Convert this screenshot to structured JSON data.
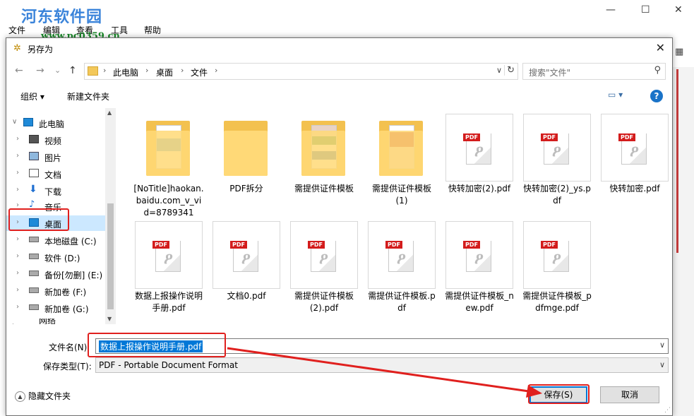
{
  "bg_app": {
    "menu": [
      "文件",
      "编辑",
      "查看",
      "工具",
      "帮助"
    ],
    "watermark": "河东软件园",
    "watermark_url": "www.pc0359.cn",
    "win_min": "—",
    "win_max": "☐",
    "win_close": "✕"
  },
  "dialog": {
    "title": "另存为",
    "close": "✕",
    "nav": {
      "back": "←",
      "forward": "→",
      "recent": "⌄",
      "up": "↑"
    },
    "breadcrumb": [
      "此电脑",
      "桌面",
      "文件"
    ],
    "search_placeholder": "搜索\"文件\"",
    "toolbar": {
      "organize": "组织 ▾",
      "new_folder": "新建文件夹",
      "help": "?"
    },
    "tree": [
      {
        "label": "此电脑",
        "icon": "pc-icon"
      },
      {
        "label": "视频",
        "icon": "video-icon"
      },
      {
        "label": "图片",
        "icon": "picture-icon"
      },
      {
        "label": "文档",
        "icon": "document-icon"
      },
      {
        "label": "下载",
        "icon": "download-icon"
      },
      {
        "label": "音乐",
        "icon": "music-icon"
      },
      {
        "label": "桌面",
        "icon": "desktop-icon"
      },
      {
        "label": "本地磁盘 (C:)",
        "icon": "drive-icon"
      },
      {
        "label": "软件 (D:)",
        "icon": "drive-icon"
      },
      {
        "label": "备份[勿删] (E:)",
        "icon": "drive-icon"
      },
      {
        "label": "新加卷 (F:)",
        "icon": "drive-icon"
      },
      {
        "label": "新加卷 (G:)",
        "icon": "drive-icon"
      },
      {
        "label": "网络",
        "icon": "network-icon"
      }
    ],
    "files": [
      {
        "name": "[NoTitle]haokan.baidu.com_v_vid=8789341",
        "type": "folder"
      },
      {
        "name": "PDF拆分",
        "type": "folder"
      },
      {
        "name": "需提供证件模板",
        "type": "folder"
      },
      {
        "name": "需提供证件模板(1)",
        "type": "folder"
      },
      {
        "name": "快转加密(2).pdf",
        "type": "pdf"
      },
      {
        "name": "快转加密(2)_ys.pdf",
        "type": "pdf"
      },
      {
        "name": "快转加密.pdf",
        "type": "pdf"
      },
      {
        "name": "数据上报操作说明手册.pdf",
        "type": "pdf"
      },
      {
        "name": "文档0.pdf",
        "type": "pdf"
      },
      {
        "name": "需提供证件模板(2).pdf",
        "type": "pdf"
      },
      {
        "name": "需提供证件模板.pdf",
        "type": "pdf"
      },
      {
        "name": "需提供证件模板_new.pdf",
        "type": "pdf"
      },
      {
        "name": "需提供证件模板_pdfmge.pdf",
        "type": "pdf"
      }
    ],
    "pdf_badge": "PDF",
    "filename_label": "文件名(N):",
    "filename_value": "数据上报操作说明手册.pdf",
    "filetype_label": "保存类型(T):",
    "filetype_value": "PDF - Portable Document Format",
    "hide_folders": "隐藏文件夹",
    "save_button": "保存(S)",
    "cancel_button": "取消"
  },
  "colors": {
    "accent": "#0078d7",
    "annotation": "#e0201e",
    "selection": "#cce8ff"
  }
}
